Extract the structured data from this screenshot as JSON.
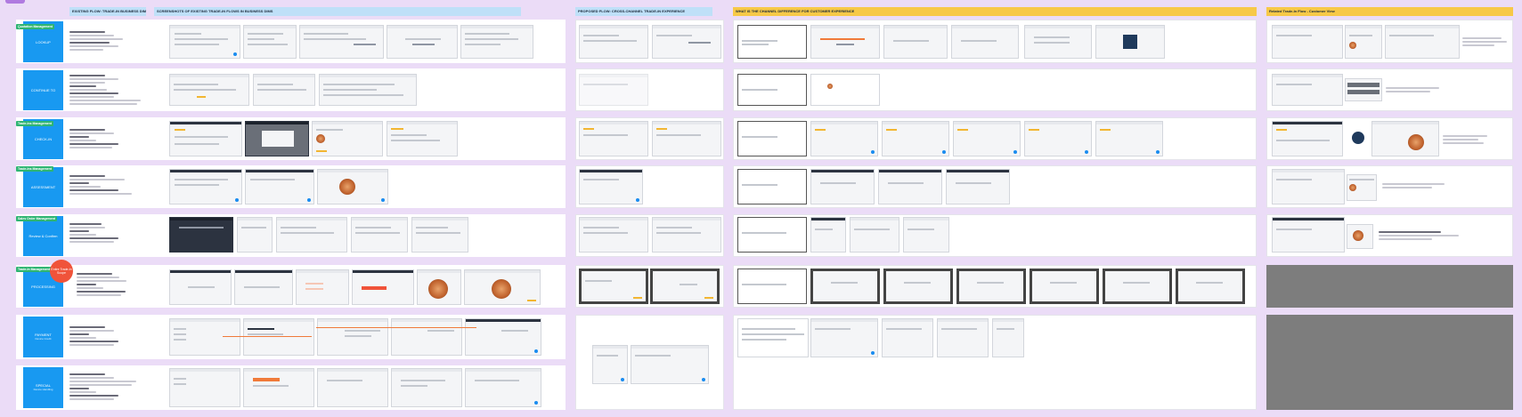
{
  "headers": [
    {
      "label": "EXISTING FLOW: TRADE-IN BUSINESS DIMS",
      "color": "#bfe0f8"
    },
    {
      "label": "SCREENSHOTS OF EXISTING TRADE-IN FLOWS IN BUSINESS DIMS",
      "color": "#bfe0f8"
    },
    {
      "label": "PROPOSED FLOW: CROSS-CHANNEL TRADE-IN EXPERIENCE",
      "color": "#bfe0f8"
    },
    {
      "label": "WHAT IS THE CHANNEL DIFFERENCE FOR CUSTOMER EXPERIENCE",
      "color": "#f7c948"
    },
    {
      "label": "Related Trade-In Flow - Customer View",
      "color": "#f7c948"
    }
  ],
  "tags": [
    {
      "label": "Quotation Management"
    },
    {
      "label": "Trade-Ins Management"
    },
    {
      "label": "Trade-Ins Management"
    },
    {
      "label": "Sales Order Management"
    },
    {
      "label": "Trade-In Management"
    }
  ],
  "rows": [
    {
      "title": "LOOKUP",
      "subtitle": ""
    },
    {
      "title": "CONTINUE TO",
      "subtitle": ""
    },
    {
      "title": "CHECK-IN",
      "subtitle": ""
    },
    {
      "title": "ASSESSMENT",
      "subtitle": ""
    },
    {
      "title": "Review & Confirm",
      "subtitle": ""
    },
    {
      "title": "PROCESSING",
      "subtitle": ""
    },
    {
      "title": "PAYMENT",
      "subtitle": "Device Credit"
    },
    {
      "title": "SPECIAL",
      "subtitle": "Device Handling"
    }
  ],
  "badge": {
    "label": "Entire Trade-In Scope"
  }
}
